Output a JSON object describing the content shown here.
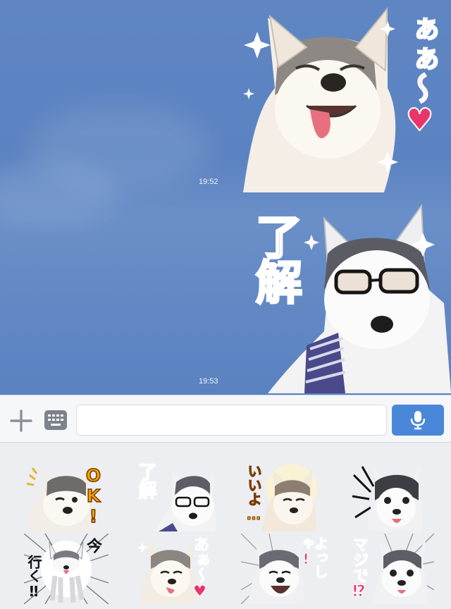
{
  "chat": {
    "messages": [
      {
        "time": "19:52",
        "sticker_text": "ぁぁ〜♥"
      },
      {
        "time": "19:53",
        "sticker_text": "了解"
      }
    ]
  },
  "input": {
    "placeholder": "",
    "value": ""
  },
  "picker": {
    "stickers": [
      {
        "text": "OK!"
      },
      {
        "text": "了解"
      },
      {
        "text": "いいよ…"
      },
      {
        "text": ""
      },
      {
        "text_a": "今",
        "text_b": "行く‼"
      },
      {
        "text": "あぁ〜♥"
      },
      {
        "text": "よっしゃ!"
      },
      {
        "text": "マジで⁉"
      }
    ]
  },
  "colors": {
    "accent": "#4b87d8",
    "sticker_pink": "#e8356b",
    "sticker_blue": "#1f3fa8",
    "chat_bg": "#5f86c3"
  }
}
